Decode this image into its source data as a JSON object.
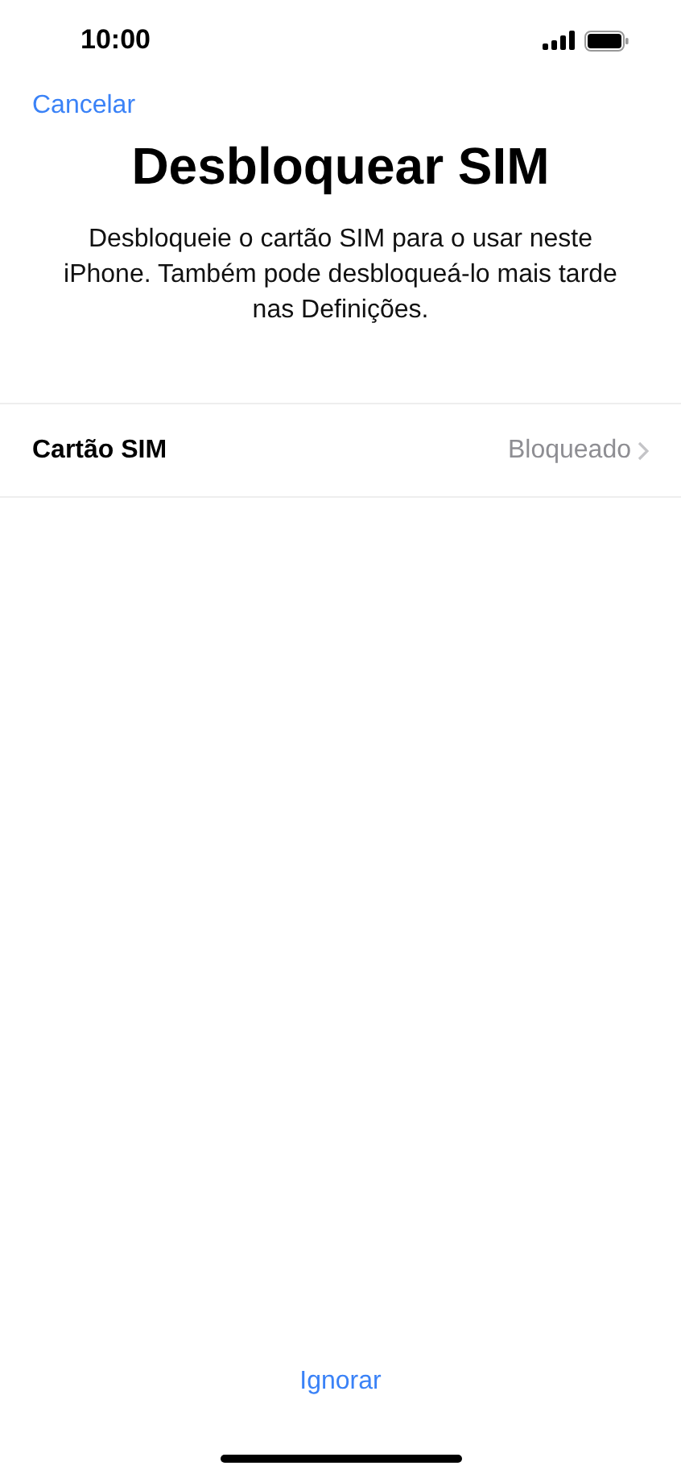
{
  "status_bar": {
    "time": "10:00"
  },
  "nav": {
    "cancel": "Cancelar"
  },
  "title": "Desbloquear SIM",
  "description": "Desbloqueie o cartão SIM para o usar neste iPhone. Também pode desbloqueá-lo mais tarde nas Definições.",
  "rows": [
    {
      "label": "Cartão SIM",
      "value": "Bloqueado"
    }
  ],
  "footer": {
    "skip": "Ignorar"
  }
}
